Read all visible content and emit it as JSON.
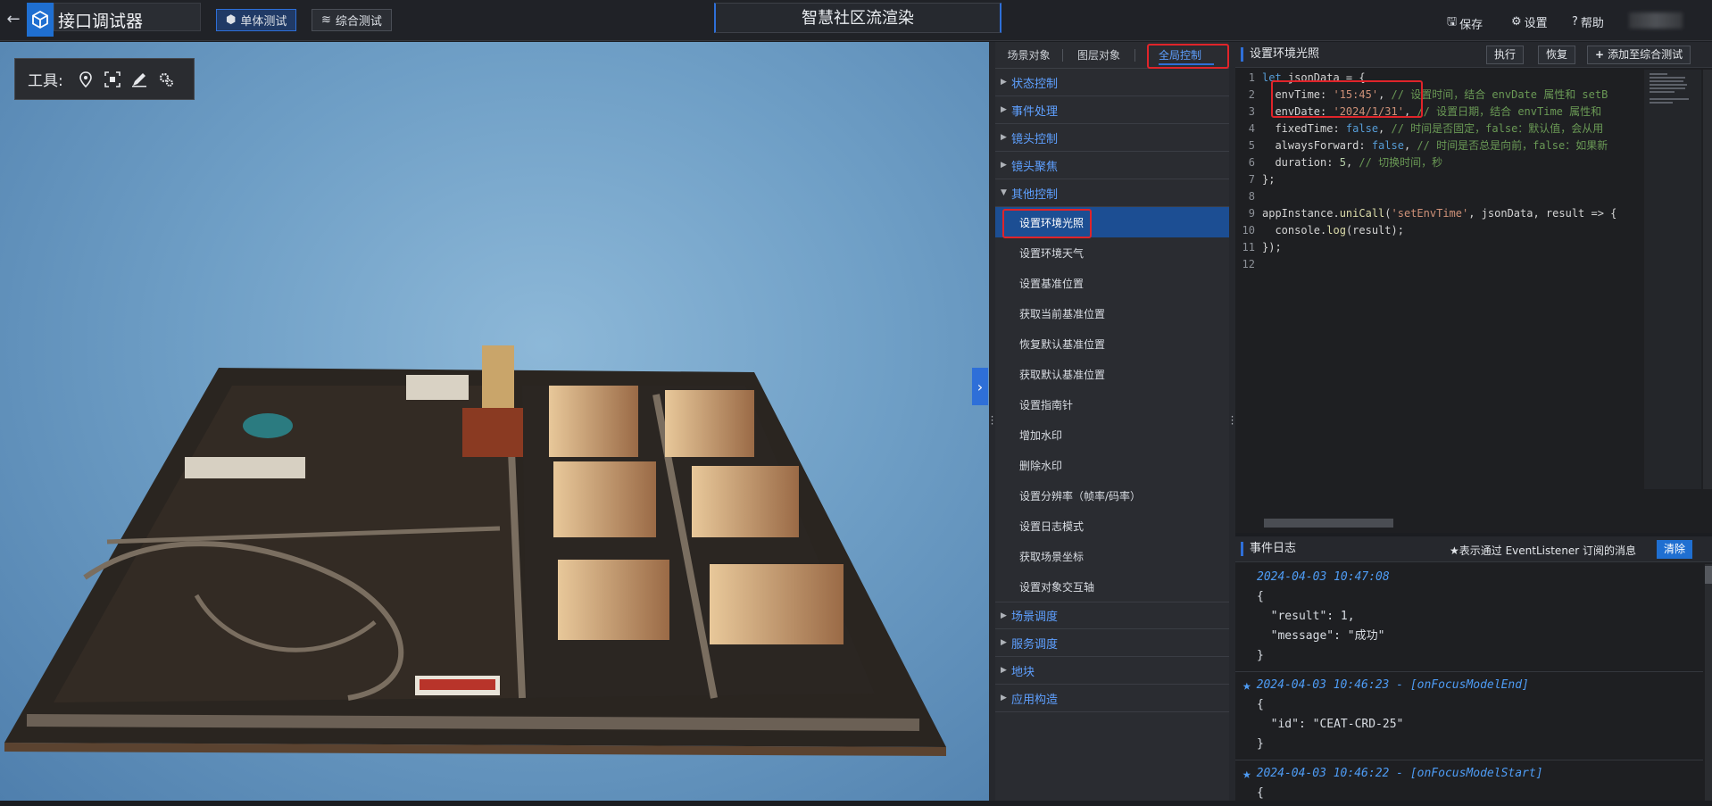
{
  "header": {
    "app_title": "接口调试器",
    "mode_tabs": [
      {
        "label": "单体测试",
        "active": true
      },
      {
        "label": "综合测试",
        "active": false
      }
    ],
    "project_title": "智慧社区流渲染",
    "actions": {
      "save": "保存",
      "settings": "设置",
      "help": "帮助"
    }
  },
  "viewport": {
    "tools_label": "工具:",
    "tool_icons": [
      "location-pin-icon",
      "frame-select-icon",
      "pen-icon",
      "gears-icon"
    ]
  },
  "nav": {
    "tabs": [
      {
        "label": "场景对象",
        "active": false
      },
      {
        "label": "图层对象",
        "active": false
      },
      {
        "label": "全局控制",
        "active": true
      }
    ],
    "sections_before": [
      "状态控制",
      "事件处理",
      "镜头控制",
      "镜头聚焦"
    ],
    "open_section": "其他控制",
    "items": [
      "设置环境光照",
      "设置环境天气",
      "设置基准位置",
      "获取当前基准位置",
      "恢复默认基准位置",
      "获取默认基准位置",
      "设置指南针",
      "增加水印",
      "删除水印",
      "设置分辨率（帧率/码率）",
      "设置日志模式",
      "获取场景坐标",
      "设置对象交互轴"
    ],
    "active_item_index": 0,
    "sections_after": [
      "场景调度",
      "服务调度",
      "地块",
      "应用构造"
    ]
  },
  "editor": {
    "title": "设置环境光照",
    "buttons": {
      "run": "执行",
      "restore": "恢复",
      "add_to_integration": "添加至综合测试"
    },
    "line_numbers": [
      "1",
      "2",
      "3",
      "4",
      "5",
      "6",
      "7",
      "8",
      "9",
      "10",
      "11",
      "12"
    ],
    "code": {
      "l1_kw": "let",
      "l1_rest": " jsonData = {",
      "l2_key": "  envTime: ",
      "l2_str": "'15:45'",
      "l2_comma": ", ",
      "l2_cm": "// 设置时间，结合 envDate 属性和 setB",
      "l3_key": "  envDate: ",
      "l3_str": "'2024/1/31'",
      "l3_comma": ", ",
      "l3_cm": "// 设置日期，结合 envTime 属性和 ",
      "l4_key": "  fixedTime: ",
      "l4_kw": "false",
      "l4_comma": ", ",
      "l4_cm": "// 时间是否固定，false：默认值，会从用",
      "l5_key": "  alwaysForward: ",
      "l5_kw": "false",
      "l5_comma": ", ",
      "l5_cm": "// 时间是否总是向前，false：如果新",
      "l6_key": "  duration: ",
      "l6_num": "5",
      "l6_comma": ", ",
      "l6_cm": "// 切换时间，秒",
      "l7": "};",
      "l9_obj": "appInstance.",
      "l9_fn": "uniCall",
      "l9_p1": "(",
      "l9_str": "'setEnvTime'",
      "l9_rest": ", jsonData, result => {",
      "l10_obj": "  console.",
      "l10_fn": "log",
      "l10_rest": "(result);",
      "l11": "});"
    }
  },
  "log": {
    "title": "事件日志",
    "note": "表示通过 EventListener 订阅的消息",
    "clear": "清除",
    "entries": [
      {
        "ts": "2024-04-03 10:47:08",
        "lines": [
          "{",
          "  \"result\": 1,",
          "  \"message\": \"成功\"",
          "}"
        ]
      },
      {
        "ts": "2024-04-03 10:46:23 - [onFocusModelEnd]",
        "lines": [
          "{",
          "  \"id\": \"CEAT-CRD-25\"",
          "}"
        ]
      },
      {
        "ts": "2024-04-03 10:46:22 - [onFocusModelStart]",
        "lines": [
          "{"
        ]
      }
    ]
  },
  "colors": {
    "accent": "#2e6fd8",
    "highlight_box": "#e0242a",
    "active_item_bg": "#1c4e93"
  }
}
